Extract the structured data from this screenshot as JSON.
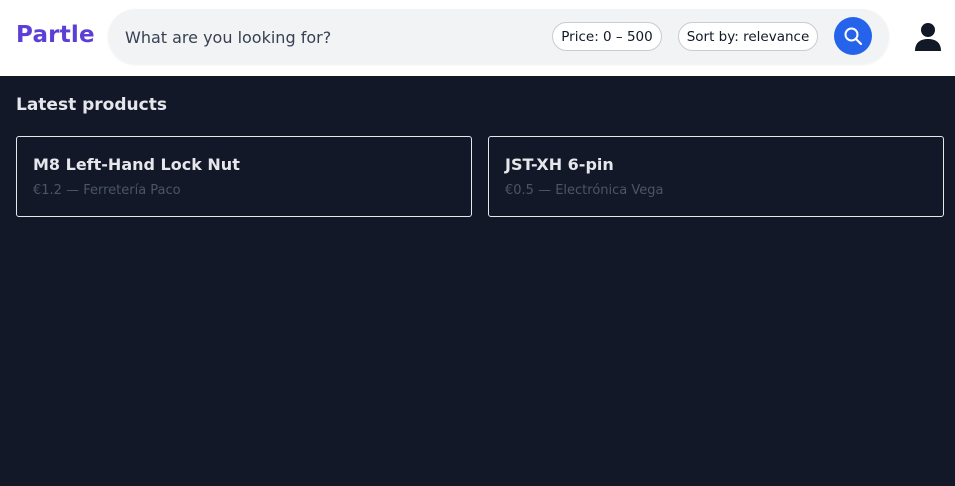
{
  "header": {
    "logo": "Partle",
    "search": {
      "placeholder": "What are you looking for?",
      "value": ""
    },
    "price_filter_label": "Price: 0 – 500",
    "sort_label": "Sort by: relevance",
    "search_icon": "search-icon",
    "user_icon": "user-icon"
  },
  "main": {
    "section_title": "Latest products",
    "products": [
      {
        "name": "M8 Left-Hand Lock Nut",
        "meta": "€1.2 — Ferretería Paco"
      },
      {
        "name": "JST-XH 6-pin",
        "meta": "€0.5 — Electrónica Vega"
      }
    ]
  },
  "colors": {
    "brand": "#5b3fd6",
    "accent": "#2563eb",
    "background": "#121828"
  }
}
